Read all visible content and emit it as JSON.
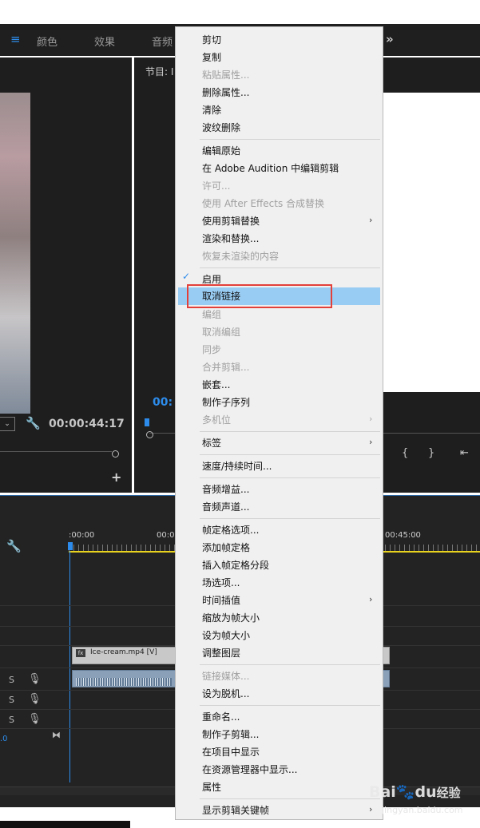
{
  "top_tabs": [
    "颜色",
    "效果",
    "音频"
  ],
  "program_label": "节目: I",
  "source_timecode": "00:00:44:17",
  "program_timecode": "00:",
  "timeline": {
    "ruler_start": ":00:00",
    "ruler_mid": "00:0",
    "ruler_end": "00:45:00",
    "clip_label": "Ice-cream.mp4 [V]",
    "track_s": "S"
  },
  "menu": {
    "items": [
      {
        "label": "剪切",
        "enabled": true
      },
      {
        "label": "复制",
        "enabled": true
      },
      {
        "label": "粘贴属性...",
        "enabled": false
      },
      {
        "label": "删除属性...",
        "enabled": true
      },
      {
        "label": "清除",
        "enabled": true
      },
      {
        "label": "波纹删除",
        "enabled": true
      },
      {
        "label": "编辑原始",
        "enabled": true
      },
      {
        "label": "在 Adobe Audition 中编辑剪辑",
        "enabled": true
      },
      {
        "label": "许可...",
        "enabled": false
      },
      {
        "label": "使用 After Effects 合成替换",
        "enabled": false
      },
      {
        "label": "使用剪辑替换",
        "enabled": true,
        "submenu": true
      },
      {
        "label": "渲染和替换...",
        "enabled": true
      },
      {
        "label": "恢复未渲染的内容",
        "enabled": false
      },
      {
        "label": "启用",
        "enabled": true,
        "checked": true
      },
      {
        "label": "取消链接",
        "enabled": true,
        "highlighted": true
      },
      {
        "label": "编组",
        "enabled": false
      },
      {
        "label": "取消编组",
        "enabled": false
      },
      {
        "label": "同步",
        "enabled": false
      },
      {
        "label": "合并剪辑...",
        "enabled": false
      },
      {
        "label": "嵌套...",
        "enabled": true
      },
      {
        "label": "制作子序列",
        "enabled": true
      },
      {
        "label": "多机位",
        "enabled": false,
        "submenu": true
      },
      {
        "label": "标签",
        "enabled": true,
        "submenu": true
      },
      {
        "label": "速度/持续时间...",
        "enabled": true
      },
      {
        "label": "音频增益...",
        "enabled": true
      },
      {
        "label": "音频声道...",
        "enabled": true
      },
      {
        "label": "帧定格选项...",
        "enabled": true
      },
      {
        "label": "添加帧定格",
        "enabled": true
      },
      {
        "label": "插入帧定格分段",
        "enabled": true
      },
      {
        "label": "场选项...",
        "enabled": true
      },
      {
        "label": "时间插值",
        "enabled": true,
        "submenu": true
      },
      {
        "label": "缩放为帧大小",
        "enabled": true
      },
      {
        "label": "设为帧大小",
        "enabled": true
      },
      {
        "label": "调整图层",
        "enabled": true
      },
      {
        "label": "链接媒体...",
        "enabled": false
      },
      {
        "label": "设为脱机...",
        "enabled": true
      },
      {
        "label": "重命名...",
        "enabled": true
      },
      {
        "label": "制作子剪辑...",
        "enabled": true
      },
      {
        "label": "在项目中显示",
        "enabled": true
      },
      {
        "label": "在资源管理器中显示...",
        "enabled": true
      },
      {
        "label": "属性",
        "enabled": true
      },
      {
        "label": "显示剪辑关键帧",
        "enabled": true,
        "submenu": true
      }
    ]
  },
  "watermark": {
    "brand": "Bai",
    "brand2": "du",
    "suffix": "经验",
    "url": "jingyan.baidu.com"
  },
  "colors": {
    "highlight": "#99ccf2",
    "annotation": "#e3403a",
    "accent": "#2d8ceb"
  }
}
